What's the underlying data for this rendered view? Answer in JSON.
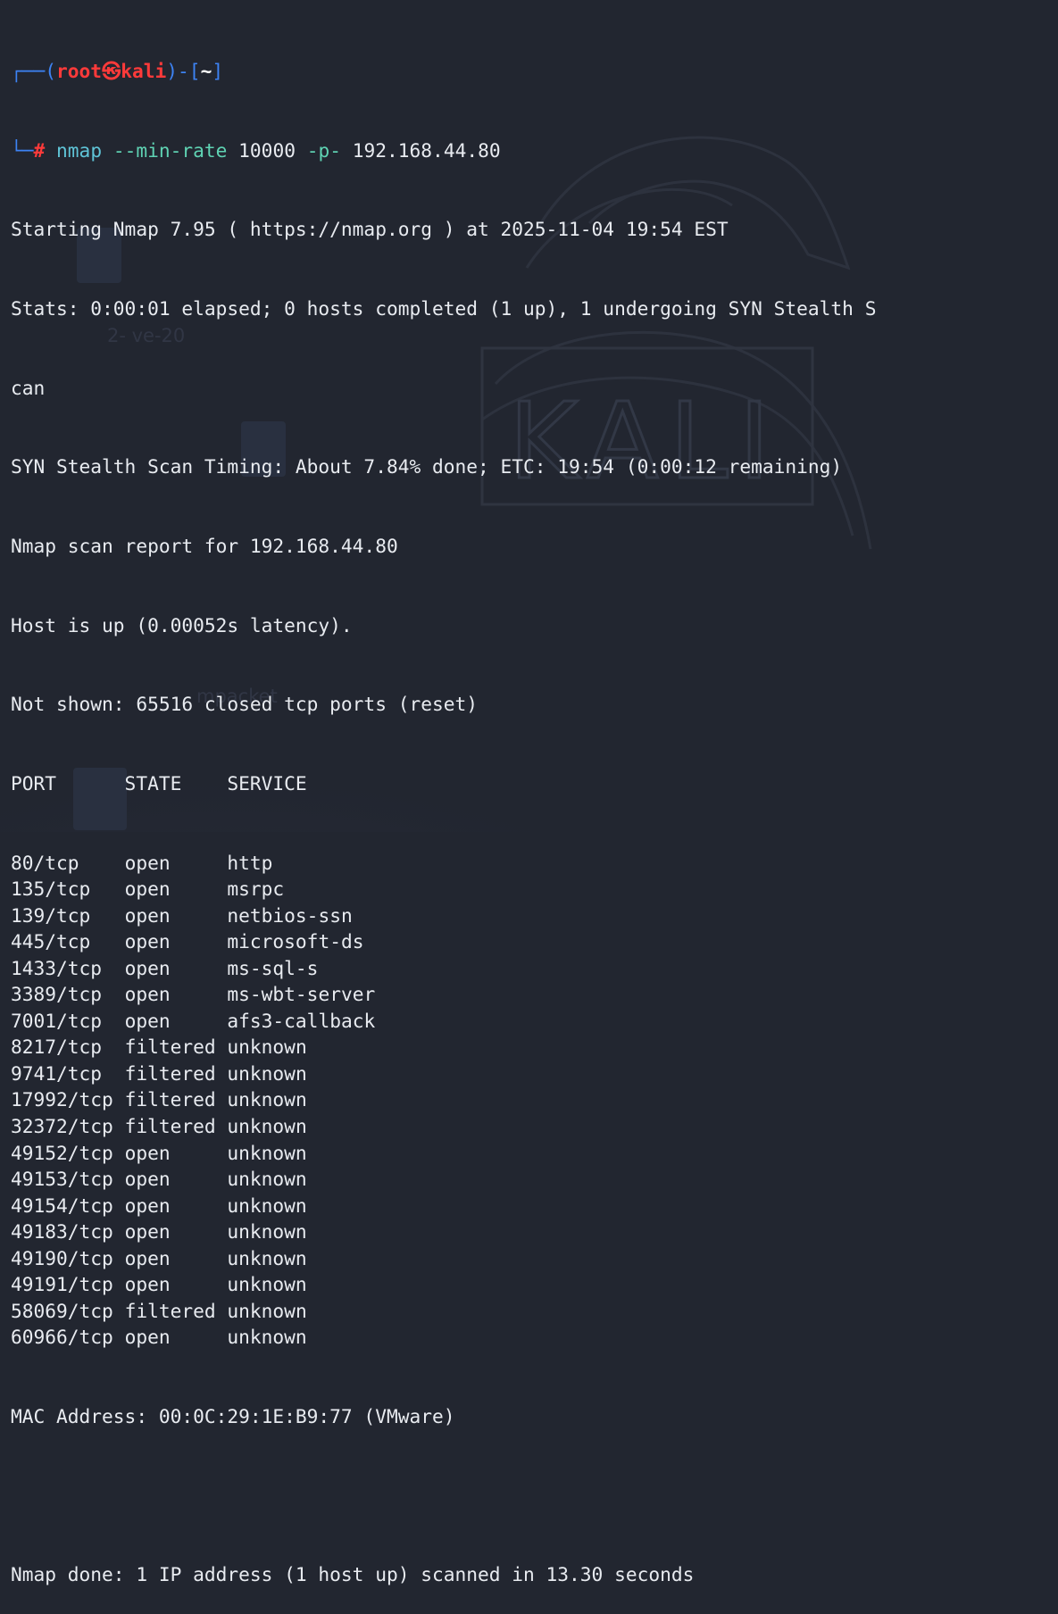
{
  "prompt": {
    "user": "root",
    "at_symbol": "㉿",
    "host": "kali",
    "cwd": "~",
    "symbol": "#"
  },
  "command": {
    "program": "nmap",
    "flag_min_rate": "--min-rate",
    "rate_value": "10000",
    "flag_ports": "-p-",
    "target": "192.168.44.80"
  },
  "output": {
    "header_lines": [
      "Starting Nmap 7.95 ( https://nmap.org ) at 2025-11-04 19:54 EST",
      "Stats: 0:00:01 elapsed; 0 hosts completed (1 up), 1 undergoing SYN Stealth S",
      "can",
      "SYN Stealth Scan Timing: About 7.84% done; ETC: 19:54 (0:00:12 remaining)",
      "Nmap scan report for 192.168.44.80",
      "Host is up (0.00052s latency).",
      "Not shown: 65516 closed tcp ports (reset)"
    ],
    "table_header": "PORT      STATE    SERVICE",
    "ports": [
      {
        "port": "80/tcp",
        "state": "open",
        "service": "http"
      },
      {
        "port": "135/tcp",
        "state": "open",
        "service": "msrpc"
      },
      {
        "port": "139/tcp",
        "state": "open",
        "service": "netbios-ssn"
      },
      {
        "port": "445/tcp",
        "state": "open",
        "service": "microsoft-ds"
      },
      {
        "port": "1433/tcp",
        "state": "open",
        "service": "ms-sql-s"
      },
      {
        "port": "3389/tcp",
        "state": "open",
        "service": "ms-wbt-server"
      },
      {
        "port": "7001/tcp",
        "state": "open",
        "service": "afs3-callback"
      },
      {
        "port": "8217/tcp",
        "state": "filtered",
        "service": "unknown"
      },
      {
        "port": "9741/tcp",
        "state": "filtered",
        "service": "unknown"
      },
      {
        "port": "17992/tcp",
        "state": "filtered",
        "service": "unknown"
      },
      {
        "port": "32372/tcp",
        "state": "filtered",
        "service": "unknown"
      },
      {
        "port": "49152/tcp",
        "state": "open",
        "service": "unknown"
      },
      {
        "port": "49153/tcp",
        "state": "open",
        "service": "unknown"
      },
      {
        "port": "49154/tcp",
        "state": "open",
        "service": "unknown"
      },
      {
        "port": "49183/tcp",
        "state": "open",
        "service": "unknown"
      },
      {
        "port": "49190/tcp",
        "state": "open",
        "service": "unknown"
      },
      {
        "port": "49191/tcp",
        "state": "open",
        "service": "unknown"
      },
      {
        "port": "58069/tcp",
        "state": "filtered",
        "service": "unknown"
      },
      {
        "port": "60966/tcp",
        "state": "open",
        "service": "unknown"
      }
    ],
    "mac_line": "MAC Address: 00:0C:29:1E:B9:77 (VMware)",
    "footer_partial": "Nmap done: 1 IP address (1 host up) scanned in 13.30 seconds"
  },
  "wallpaper": {
    "logo_text": "KALI",
    "desktop_icon_labels": [
      "2-  ve-20",
      "mpacket"
    ]
  },
  "colors": {
    "background": "#222630",
    "text": "#e8ebf0",
    "prompt_box": "#3d83f4",
    "prompt_user_host": "#ff3a3a",
    "command": "#5fc4d7"
  }
}
